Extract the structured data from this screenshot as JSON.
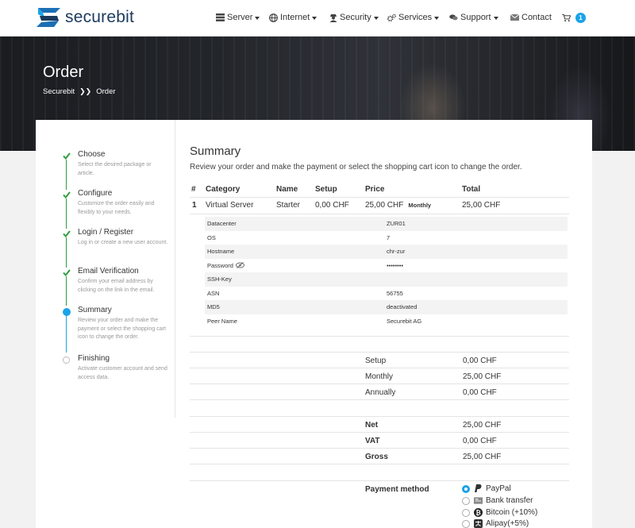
{
  "brand": {
    "name": "securebit",
    "colors": {
      "accent": "#1aa3e8",
      "brand": "#1b3a5c",
      "check": "#2e9e3e"
    }
  },
  "nav": {
    "items": [
      {
        "label": "Server",
        "icon": "server-icon"
      },
      {
        "label": "Internet",
        "icon": "globe-icon"
      },
      {
        "label": "Security",
        "icon": "user-secret-icon"
      },
      {
        "label": "Services",
        "icon": "cogs-icon"
      },
      {
        "label": "Support",
        "icon": "comments-icon"
      },
      {
        "label": "Contact",
        "icon": "envelope-icon"
      }
    ],
    "cart_count": "1"
  },
  "hero": {
    "title": "Order",
    "breadcrumb": [
      "Securebit",
      "Order"
    ]
  },
  "steps": [
    {
      "title": "Choose",
      "desc": "Select the desired package or article.",
      "state": "done"
    },
    {
      "title": "Configure",
      "desc": "Customize the order easily and flexibly to your needs.",
      "state": "done"
    },
    {
      "title": "Login / Register",
      "desc": "Log in or create a new user account.",
      "state": "done"
    },
    {
      "title": "Email Verification",
      "desc": "Confirm your email address by clicking on the link in the email.",
      "state": "done"
    },
    {
      "title": "Summary",
      "desc": "Review your order and make the payment or select the shopping cart icon to change the order.",
      "state": "active"
    },
    {
      "title": "Finishing",
      "desc": "Activate customer account and send access data.",
      "state": "open"
    }
  ],
  "summary": {
    "title": "Summary",
    "subtitle": "Review your order and make the payment or select the shopping cart icon to change the order.",
    "columns": [
      "#",
      "Category",
      "Name",
      "Setup",
      "Price",
      "Total"
    ],
    "row": {
      "num": "1",
      "category": "Virtual Server",
      "name": "Starter",
      "setup": "0,00 CHF",
      "price": "25,00 CHF",
      "period": "Monthly",
      "total": "25,00 CHF"
    },
    "details": [
      {
        "key": "Datacenter",
        "value": "ZUR01"
      },
      {
        "key": "OS",
        "value": "7"
      },
      {
        "key": "Hostname",
        "value": "chr-zur"
      },
      {
        "key": "Password",
        "value": "••••••••"
      },
      {
        "key": "SSH-Key",
        "value": ""
      },
      {
        "key": "ASN",
        "value": "56755"
      },
      {
        "key": "MD5",
        "value": "deactivated"
      },
      {
        "key": "Peer Name",
        "value": "Securebit AG"
      }
    ],
    "totals1": [
      {
        "label": "Setup",
        "value": "0,00 CHF"
      },
      {
        "label": "Monthly",
        "value": "25,00 CHF"
      },
      {
        "label": "Annually",
        "value": "0,00 CHF"
      }
    ],
    "totals2": [
      {
        "label": "Net",
        "value": "25,00 CHF"
      },
      {
        "label": "VAT",
        "value": "0,00 CHF"
      },
      {
        "label": "Gross",
        "value": "25,00 CHF"
      }
    ],
    "payment": {
      "label": "Payment method",
      "options": [
        {
          "label": "PayPal",
          "icon": "paypal-icon",
          "selected": true
        },
        {
          "label": "Bank transfer",
          "icon": "bank-transfer-icon",
          "selected": false
        },
        {
          "label": "Bitcoin (+10%)",
          "icon": "bitcoin-icon",
          "selected": false
        },
        {
          "label": "Alipay(+5%)",
          "icon": "alipay-icon",
          "selected": false
        }
      ]
    }
  }
}
